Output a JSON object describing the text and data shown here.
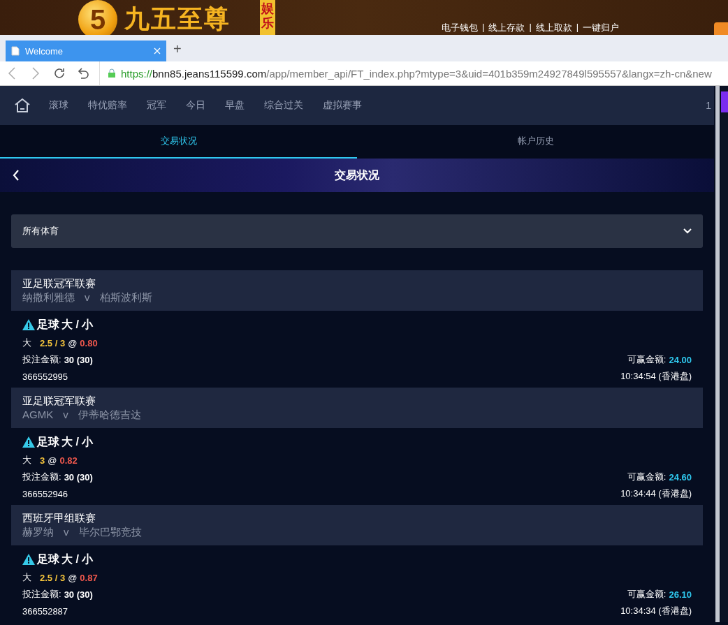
{
  "banner": {
    "logo_mark": "5",
    "logo_text": "九五至尊",
    "logo_badge": "娱乐",
    "links": [
      "电子钱包",
      "线上存款",
      "线上取款",
      "一键归户"
    ],
    "separator": "|"
  },
  "browser": {
    "tabs": [
      {
        "title": "Welcome",
        "selected": true
      }
    ],
    "new_tab": "+",
    "url_scheme": "https://",
    "url_host": "bnn85.jeans115599.com",
    "url_path": "/app/member_api/FT_index.php?mtype=3&uid=401b359m24927849l595557&langx=zh-cn&new"
  },
  "nav": {
    "items": [
      "滚球",
      "特优赔率",
      "冠军",
      "今日",
      "早盘",
      "综合过关",
      "虚拟赛事"
    ],
    "cut_text": "1"
  },
  "tabs": [
    {
      "label": "交易状况",
      "selected": true
    },
    {
      "label": "帐户历史",
      "selected": false
    }
  ],
  "header": {
    "title": "交易状况"
  },
  "filter": {
    "value": "所有体育"
  },
  "bets": [
    {
      "league": "亚足联冠军联赛",
      "home": "纳撒利雅德",
      "vs": "v",
      "away": "柏斯波利斯",
      "sport": "足球",
      "market": "大 / 小",
      "pick": "大",
      "line": "2.5 / 3",
      "at": "@",
      "odds": "0.80",
      "stake_label": "投注金额:",
      "stake": "30 (30)",
      "win_label": "可赢金额:",
      "win": "24.00",
      "ticket": "366552995",
      "time": "10:34:54 (香港盘)"
    },
    {
      "league": "亚足联冠军联赛",
      "home": "AGMK",
      "vs": "v",
      "away": "伊蒂哈德吉达",
      "sport": "足球",
      "market": "大 / 小",
      "pick": "大",
      "line": "3",
      "at": "@",
      "odds": "0.82",
      "stake_label": "投注金额:",
      "stake": "30 (30)",
      "win_label": "可赢金额:",
      "win": "24.60",
      "ticket": "366552946",
      "time": "10:34:44 (香港盘)"
    },
    {
      "league": "西班牙甲组联赛",
      "home": "赫罗纳",
      "vs": "v",
      "away": "毕尔巴鄂竞技",
      "sport": "足球",
      "market": "大 / 小",
      "pick": "大",
      "line": "2.5 / 3",
      "at": "@",
      "odds": "0.87",
      "stake_label": "投注金额:",
      "stake": "30 (30)",
      "win_label": "可赢金额:",
      "win": "26.10",
      "ticket": "366552887",
      "time": "10:34:34 (香港盘)"
    }
  ]
}
